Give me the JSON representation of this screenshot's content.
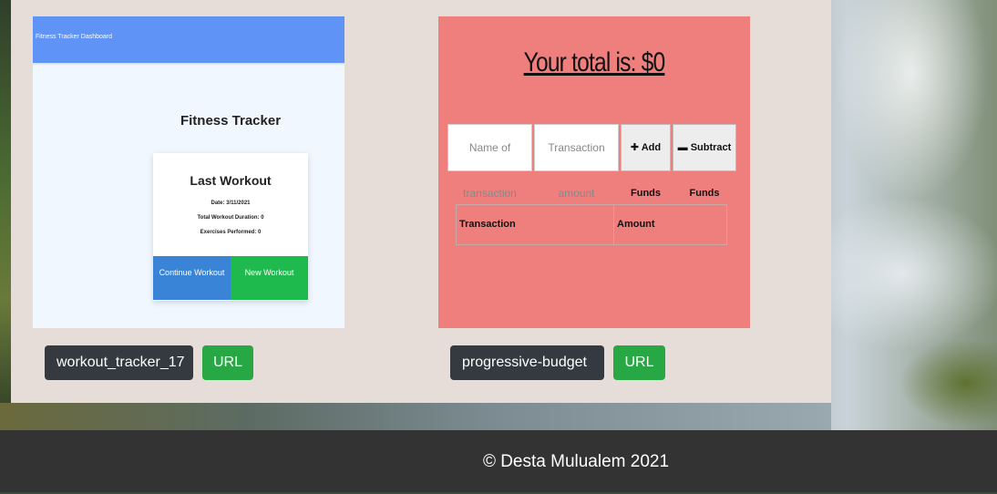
{
  "projects": [
    {
      "name": "workout_tracker_17",
      "url_label": "URL",
      "screenshot": {
        "header": "Fitness Tracker Dashboard",
        "title": "Fitness Tracker",
        "card_title": "Last Workout",
        "date": "Date: 3/11/2021",
        "duration": "Total Workout Duration: 0",
        "exercises": "Exercises Performed: 0",
        "continue_button": "Continue Workout",
        "new_button": "New Workout"
      }
    },
    {
      "name": "progressive-budget",
      "url_label": "URL",
      "screenshot": {
        "total": "Your total is: $0",
        "name_placeholder": "Name of transaction",
        "amount_placeholder": "Transaction amount",
        "add_button": "✚ Add Funds",
        "subtract_button": "▬ Subtract Funds",
        "col_transaction": "Transaction",
        "col_amount": "Amount"
      }
    }
  ],
  "footer": {
    "copyright": "© Desta Mulualem 2021"
  }
}
